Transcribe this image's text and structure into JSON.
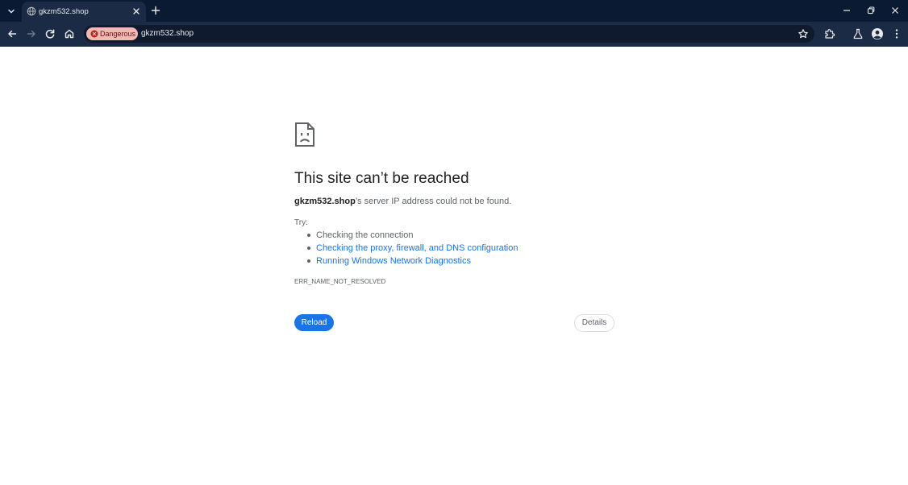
{
  "browser": {
    "tab": {
      "title": "gkzm532.shop"
    },
    "omnibox": {
      "security_chip": "Dangerous",
      "url": "gkzm532.shop"
    }
  },
  "icons": {
    "tab_search": "chevron-down-icon",
    "favicon": "globe-icon",
    "tab_close": "close-icon",
    "new_tab": "plus-icon",
    "minimize": "minimize-icon",
    "restore": "restore-icon",
    "close_window": "close-icon",
    "back": "arrow-left-icon",
    "forward": "arrow-right-icon",
    "reload": "reload-icon",
    "home": "home-icon",
    "danger": "danger-icon",
    "bookmark": "star-icon",
    "extensions": "puzzle-icon",
    "labs": "flask-icon",
    "profile": "avatar-icon",
    "menu": "kebab-menu-icon",
    "sad_page": "sad-document-icon"
  },
  "colors": {
    "frame": "#0b1a33",
    "toolbar": "#1c2b45",
    "danger_chip": "#f2b8b5",
    "accent": "#1a73e8"
  },
  "error_page": {
    "heading": "This site can’t be reached",
    "host": "gkzm532.shop",
    "description_suffix": "’s server IP address could not be found.",
    "try_label": "Try:",
    "suggestions": [
      "Checking the connection",
      "Checking the proxy, firewall, and DNS configuration",
      "Running Windows Network Diagnostics"
    ],
    "error_code": "ERR_NAME_NOT_RESOLVED",
    "reload_label": "Reload",
    "details_label": "Details"
  }
}
